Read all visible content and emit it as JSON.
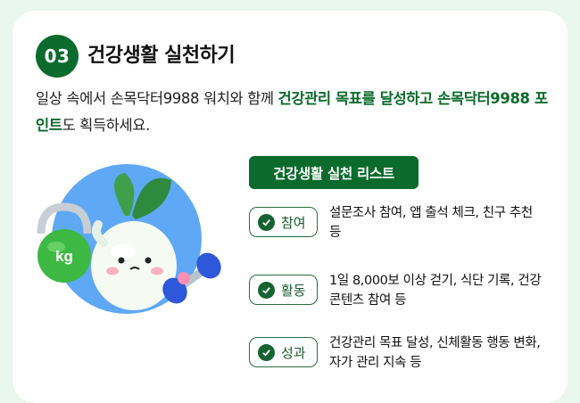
{
  "section": {
    "number": "03",
    "title": "건강생활 실천하기"
  },
  "description": {
    "part1": "일상 속에서 손목닥터9988 워치와 함께 ",
    "highlight1": "건강관리 목표를 달성하고 손목닥터9988 포인트",
    "part2": "도 획득하세요."
  },
  "illustration": {
    "weight_label": "kg",
    "icons": [
      "kettlebell-icon",
      "radish-character-icon",
      "dumbbell-icon"
    ]
  },
  "list": {
    "title": "건강생활 실천 리스트",
    "items": [
      {
        "label": "참여",
        "text": "설문조사 참여, 앱 출석 체크, 친구 추천 등"
      },
      {
        "label": "활동",
        "text": "1일 8,000보 이상 걷기, 식단 기록, 건강 콘텐츠 참여 등"
      },
      {
        "label": "성과",
        "text": "건강관리 목표 달성, 신체활동 행동 변화, 자가 관리 지속 등"
      }
    ]
  },
  "colors": {
    "brand_green": "#0b6b2c",
    "page_background": "#e9f7ee",
    "sky_blue": "#5fa8f5"
  }
}
